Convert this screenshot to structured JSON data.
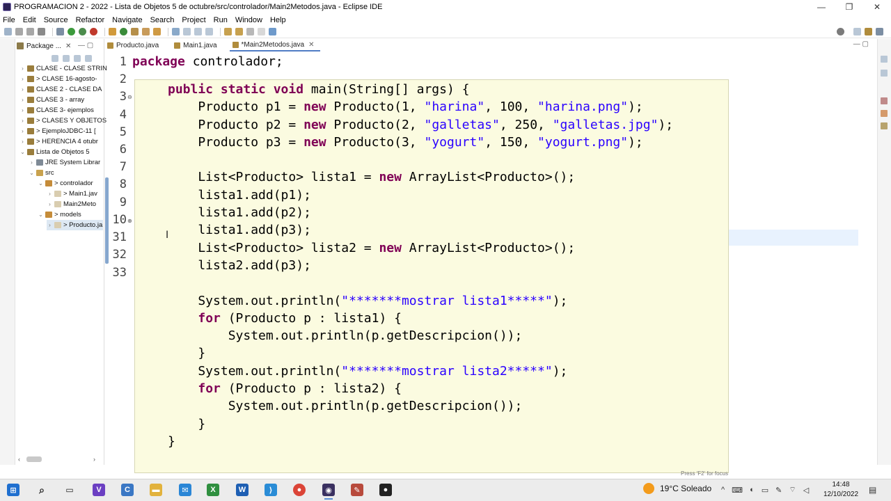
{
  "window": {
    "title": "PROGRAMACION 2 - 2022 - Lista de Objetos 5 de octubre/src/controlador/Main2Metodos.java - Eclipse IDE",
    "controls": {
      "minimize": "—",
      "maximize": "❐",
      "close": "✕"
    }
  },
  "menu": [
    "File",
    "Edit",
    "Source",
    "Refactor",
    "Navigate",
    "Search",
    "Project",
    "Run",
    "Window",
    "Help"
  ],
  "package_explorer": {
    "tab_label": "Package ...",
    "items": [
      {
        "label": "CLASE - CLASE STRIN",
        "twisty": "›"
      },
      {
        "label": "> CLASE 16-agosto-",
        "twisty": "›"
      },
      {
        "label": "CLASE 2 - CLASE DA",
        "twisty": "›"
      },
      {
        "label": "CLASE 3 - array",
        "twisty": "›"
      },
      {
        "label": "CLASE 3- ejemplos",
        "twisty": "›"
      },
      {
        "label": "> CLASES Y OBJETOS",
        "twisty": "›"
      },
      {
        "label": "> EjemploJDBC-11 [",
        "twisty": "›"
      },
      {
        "label": "> HERENCIA 4 otubr",
        "twisty": "›"
      },
      {
        "label": "Lista de Objetos 5",
        "twisty": "⌄"
      },
      {
        "label": "JRE System Librar",
        "twisty": "›"
      },
      {
        "label": "src",
        "twisty": "⌄"
      },
      {
        "label": "> controlador",
        "twisty": "⌄"
      },
      {
        "label": "> Main1.jav",
        "twisty": "›"
      },
      {
        "label": "Main2Meto",
        "twisty": "›"
      },
      {
        "label": "> models",
        "twisty": "⌄"
      },
      {
        "label": "> Producto.ja",
        "twisty": "›"
      }
    ]
  },
  "editor": {
    "tabs": [
      {
        "label": "Producto.java"
      },
      {
        "label": "Main1.java"
      },
      {
        "label": "*Main2Metodos.java",
        "close": "✕"
      }
    ],
    "line_numbers": [
      "1",
      "2",
      "3",
      "4",
      "5",
      "6",
      "7",
      "8",
      "9",
      "10",
      "31",
      "32",
      "33"
    ],
    "package_line": {
      "kw": "package",
      "rest": " controlador;"
    },
    "popup_code": [
      [
        {
          "t": "public static void",
          "k": "kw"
        },
        {
          "t": " main(String[] args) {"
        }
      ],
      [
        {
          "t": "    Producto p1 = "
        },
        {
          "t": "new",
          "k": "kw"
        },
        {
          "t": " Producto(1, "
        },
        {
          "t": "\"harina\"",
          "k": "str"
        },
        {
          "t": ", 100, "
        },
        {
          "t": "\"harina.png\"",
          "k": "str"
        },
        {
          "t": ");"
        }
      ],
      [
        {
          "t": "    Producto p2 = "
        },
        {
          "t": "new",
          "k": "kw"
        },
        {
          "t": " Producto(2, "
        },
        {
          "t": "\"galletas\"",
          "k": "str"
        },
        {
          "t": ", 250, "
        },
        {
          "t": "\"galletas.jpg\"",
          "k": "str"
        },
        {
          "t": ");"
        }
      ],
      [
        {
          "t": "    Producto p3 = "
        },
        {
          "t": "new",
          "k": "kw"
        },
        {
          "t": " Producto(3, "
        },
        {
          "t": "\"yogurt\"",
          "k": "str"
        },
        {
          "t": ", 150, "
        },
        {
          "t": "\"yogurt.png\"",
          "k": "str"
        },
        {
          "t": ");"
        }
      ],
      [
        {
          "t": ""
        }
      ],
      [
        {
          "t": "    List<Producto> lista1 = "
        },
        {
          "t": "new",
          "k": "kw"
        },
        {
          "t": " ArrayList<Producto>();"
        }
      ],
      [
        {
          "t": "    lista1.add(p1);"
        }
      ],
      [
        {
          "t": "    lista1.add(p2);"
        }
      ],
      [
        {
          "t": "    lista1.add(p3);"
        }
      ],
      [
        {
          "t": "    List<Producto> lista2 = "
        },
        {
          "t": "new",
          "k": "kw"
        },
        {
          "t": " ArrayList<Producto>();"
        }
      ],
      [
        {
          "t": "    lista2.add(p3);"
        }
      ],
      [
        {
          "t": ""
        }
      ],
      [
        {
          "t": "    System.out.println("
        },
        {
          "t": "\"*******mostrar lista1*****\"",
          "k": "str"
        },
        {
          "t": ");"
        }
      ],
      [
        {
          "t": "    "
        },
        {
          "t": "for",
          "k": "kw"
        },
        {
          "t": " (Producto p : lista1) {"
        }
      ],
      [
        {
          "t": "        System.out.println(p.getDescripcion());"
        }
      ],
      [
        {
          "t": "    }"
        }
      ],
      [
        {
          "t": "    System.out.println("
        },
        {
          "t": "\"*******mostrar lista2*****\"",
          "k": "str"
        },
        {
          "t": ");"
        }
      ],
      [
        {
          "t": "    "
        },
        {
          "t": "for",
          "k": "kw"
        },
        {
          "t": " (Producto p : lista2) {"
        }
      ],
      [
        {
          "t": "        System.out.println(p.getDescripcion());"
        }
      ],
      [
        {
          "t": "    }"
        }
      ],
      [
        {
          "t": "}"
        }
      ]
    ],
    "focus_hint": "Press 'F2' for focus"
  },
  "taskbar": {
    "weather_temp": "19°C Soleado",
    "time": "14:48",
    "date": "12/10/2022"
  },
  "colors": {
    "keyword": "#7f0055",
    "string": "#2a00ff",
    "popup_bg": "#fbfbe0",
    "selection": "#dde8f3"
  }
}
